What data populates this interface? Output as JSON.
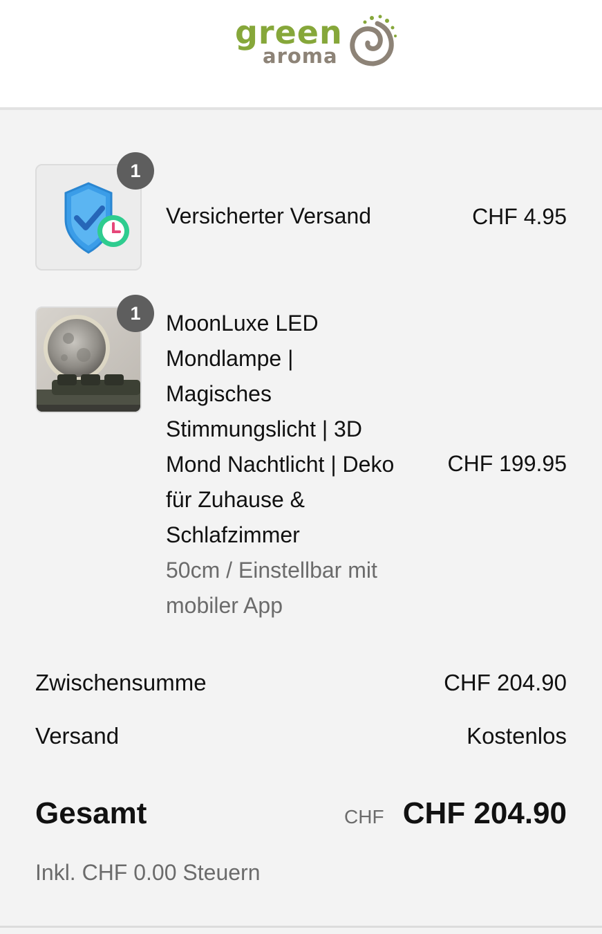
{
  "brand": {
    "logo_line1": "green",
    "logo_line2": "aroma",
    "colors": {
      "green": "#86a73a",
      "taupe": "#8d8377"
    }
  },
  "items": [
    {
      "quantity": "1",
      "title": "Versicherter Versand",
      "price": "CHF 4.95",
      "icon": "shield-check-clock-icon"
    },
    {
      "quantity": "1",
      "title_lines": [
        "MoonLuxe LED",
        "Mondlampe |",
        "Magisches",
        "Stimmungslicht | 3D",
        "Mond Nachtlicht | Deko",
        "für Zuhause &",
        "Schlafzimmer"
      ],
      "variant_lines": [
        "50cm / Einstellbar mit",
        "mobiler App"
      ],
      "price": "CHF 199.95"
    }
  ],
  "summary": {
    "subtotal_label": "Zwischensumme",
    "subtotal_value": "CHF 204.90",
    "shipping_label": "Versand",
    "shipping_value": "Kostenlos",
    "total_label": "Gesamt",
    "total_currency": "CHF",
    "total_value": "CHF 204.90",
    "tax_note": "Inkl. CHF 0.00 Steuern"
  }
}
